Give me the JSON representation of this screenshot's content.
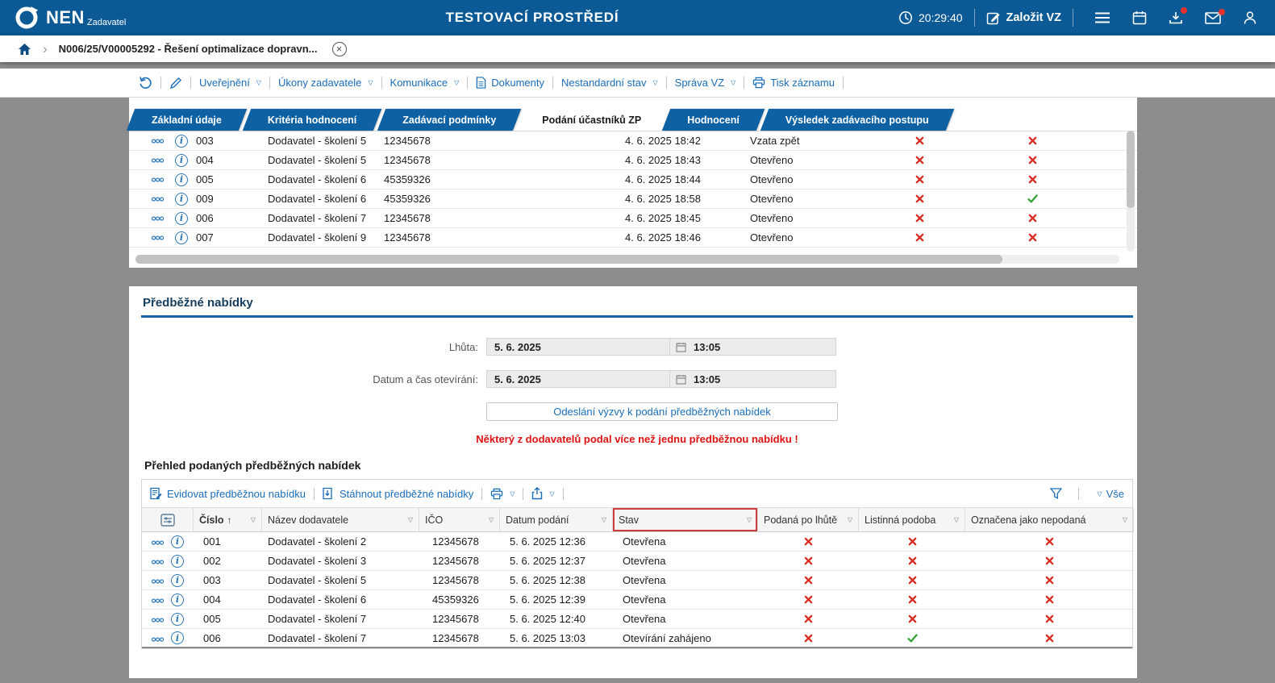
{
  "colors": {
    "header_bg": "#0b5a95",
    "tab_bg": "#0e61a3",
    "accent": "#1a6db8",
    "danger": "#d92b21",
    "success": "#33a133",
    "warning": "#e01111",
    "navy": "#163f60",
    "section_line": "#1566a8"
  },
  "header": {
    "logo": "NEN",
    "logo_subtitle": "Zadavatel",
    "title": "TESTOVACÍ PROSTŘEDÍ",
    "clock": "20:29:40",
    "create_button": "Založit VZ"
  },
  "breadcrumb": {
    "record": "N006/25/V00005292 - Řešení optimalizace dopravn..."
  },
  "record_toolbar": {
    "items": [
      {
        "label": "Uveřejnění",
        "dropdown": true
      },
      {
        "label": "Úkony zadavatele",
        "dropdown": true
      },
      {
        "label": "Komunikace",
        "dropdown": true
      },
      {
        "label": "Dokumenty",
        "icon": "document-icon"
      },
      {
        "label": "Nestandardní stav",
        "dropdown": true
      },
      {
        "label": "Správa VZ",
        "dropdown": true
      },
      {
        "label": "Tisk záznamu",
        "icon": "printer-icon"
      }
    ]
  },
  "tabs": [
    {
      "label": "Základní údaje",
      "active": false
    },
    {
      "label": "Kritéria hodnocení",
      "active": false
    },
    {
      "label": "Zadávací podmínky",
      "active": false
    },
    {
      "label": "Podání účastníků ZP",
      "active": true
    },
    {
      "label": "Hodnocení",
      "active": false
    },
    {
      "label": "Výsledek zadávacího postupu",
      "active": false
    }
  ],
  "participants_table": {
    "rows": [
      {
        "cislo": "003",
        "nazev": "Dodavatel - školení 5",
        "ico": "12345678",
        "datum": "4. 6. 2025 18:42",
        "stav": "Vzata zpět",
        "flag1": false,
        "flag2": false
      },
      {
        "cislo": "004",
        "nazev": "Dodavatel - školení 5",
        "ico": "12345678",
        "datum": "4. 6. 2025 18:43",
        "stav": "Otevřeno",
        "flag1": false,
        "flag2": false
      },
      {
        "cislo": "005",
        "nazev": "Dodavatel - školení 6",
        "ico": "45359326",
        "datum": "4. 6. 2025 18:44",
        "stav": "Otevřeno",
        "flag1": false,
        "flag2": false
      },
      {
        "cislo": "009",
        "nazev": "Dodavatel - školení 6",
        "ico": "45359326",
        "datum": "4. 6. 2025 18:58",
        "stav": "Otevřeno",
        "flag1": false,
        "flag2": true
      },
      {
        "cislo": "006",
        "nazev": "Dodavatel - školení 7",
        "ico": "12345678",
        "datum": "4. 6. 2025 18:45",
        "stav": "Otevřeno",
        "flag1": false,
        "flag2": false
      },
      {
        "cislo": "007",
        "nazev": "Dodavatel - školení 9",
        "ico": "12345678",
        "datum": "4. 6. 2025 18:46",
        "stav": "Otevřeno",
        "flag1": false,
        "flag2": false
      }
    ]
  },
  "preliminary_offers": {
    "title": "Předběžné nabídky",
    "fields": [
      {
        "label": "Lhůta:",
        "date": "5. 6. 2025",
        "time": "13:05"
      },
      {
        "label": "Datum a čas otevírání:",
        "date": "5. 6. 2025",
        "time": "13:05"
      }
    ],
    "send_button": "Odeslání výzvy k podání předběžných nabídek",
    "warning": "Některý z dodavatelů podal více než jednu předběžnou nabídku !"
  },
  "offers_overview": {
    "title": "Přehled podaných předběžných nabídek",
    "toolbar": {
      "register": "Evidovat předběžnou nabídku",
      "download": "Stáhnout předběžné nabídky",
      "filter_all": "Vše"
    },
    "columns": [
      "Číslo",
      "Název dodavatele",
      "IČO",
      "Datum podání",
      "Stav",
      "Podaná po lhůtě",
      "Listinná podoba",
      "Označena jako nepodaná"
    ],
    "sorted_column": "Číslo",
    "highlighted_column": "Stav",
    "rows": [
      {
        "cislo": "001",
        "nazev": "Dodavatel - školení 2",
        "ico": "12345678",
        "datum": "5. 6. 2025 12:36",
        "stav": "Otevřena",
        "po_lhute": false,
        "listinna": false,
        "nepodana": false
      },
      {
        "cislo": "002",
        "nazev": "Dodavatel - školení 3",
        "ico": "12345678",
        "datum": "5. 6. 2025 12:37",
        "stav": "Otevřena",
        "po_lhute": false,
        "listinna": false,
        "nepodana": false
      },
      {
        "cislo": "003",
        "nazev": "Dodavatel - školení 5",
        "ico": "12345678",
        "datum": "5. 6. 2025 12:38",
        "stav": "Otevřena",
        "po_lhute": false,
        "listinna": false,
        "nepodana": false
      },
      {
        "cislo": "004",
        "nazev": "Dodavatel - školení 6",
        "ico": "45359326",
        "datum": "5. 6. 2025 12:39",
        "stav": "Otevřena",
        "po_lhute": false,
        "listinna": false,
        "nepodana": false
      },
      {
        "cislo": "005",
        "nazev": "Dodavatel - školení 7",
        "ico": "12345678",
        "datum": "5. 6. 2025 12:40",
        "stav": "Otevřena",
        "po_lhute": false,
        "listinna": false,
        "nepodana": false
      },
      {
        "cislo": "006",
        "nazev": "Dodavatel - školení 7",
        "ico": "12345678",
        "datum": "5. 6. 2025 13:03",
        "stav": "Otevírání zahájeno",
        "po_lhute": false,
        "listinna": true,
        "nepodana": false
      }
    ]
  }
}
